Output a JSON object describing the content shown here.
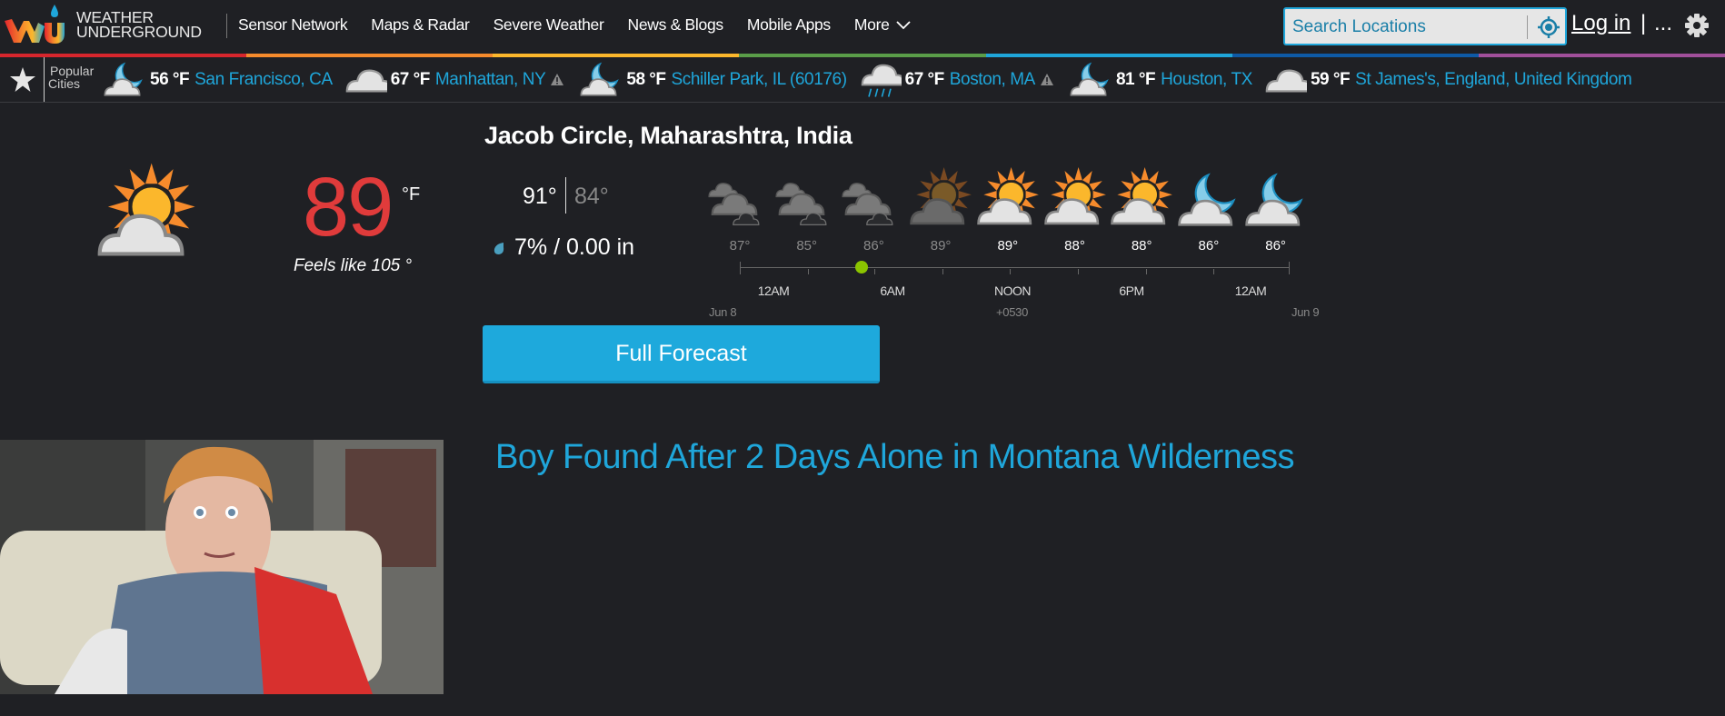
{
  "header": {
    "logo_line1": "WEATHER",
    "logo_line2": "UNDERGROUND",
    "nav": [
      "Sensor Network",
      "Maps & Radar",
      "Severe Weather",
      "News & Blogs",
      "Mobile Apps",
      "More"
    ],
    "search_placeholder": "Search Locations",
    "login_label": "Log in",
    "separator": "|",
    "more_label": "...",
    "brand_colors": [
      "#d7262d",
      "#f68b2c",
      "#fbb72c",
      "#5a9d49",
      "#1fa6da",
      "#0e5aa6",
      "#a04f9a"
    ]
  },
  "popular_cities": {
    "label_line1": "Popular",
    "label_line2": "Cities",
    "items": [
      {
        "icon": "night-partly-cloudy-icon",
        "temp": "56 °F",
        "name": "San Francisco, CA",
        "alert": false
      },
      {
        "icon": "cloudy-icon",
        "temp": "67 °F",
        "name": "Manhattan, NY",
        "alert": true
      },
      {
        "icon": "night-partly-cloudy-icon",
        "temp": "58 °F",
        "name": "Schiller Park, IL (60176)",
        "alert": false
      },
      {
        "icon": "rain-icon",
        "temp": "67 °F",
        "name": "Boston, MA",
        "alert": true
      },
      {
        "icon": "night-partly-cloudy-icon",
        "temp": "81 °F",
        "name": "Houston, TX",
        "alert": false
      },
      {
        "icon": "cloudy-icon",
        "temp": "59 °F",
        "name": "St James's, England, United Kingdom",
        "alert": false
      }
    ]
  },
  "current": {
    "location": "Jacob Circle, Maharashtra, India",
    "icon": "partly-cloudy-icon",
    "temp": "89",
    "unit": "°F",
    "feels_like": "Feels like 105 °",
    "high": "91°",
    "low": "84°",
    "precip": "7% / 0.00 in",
    "temp_color": "#e03b3b"
  },
  "hourly": {
    "items": [
      {
        "icon": "mostly-cloudy-icon",
        "temp": "87°",
        "past": true
      },
      {
        "icon": "mostly-cloudy-icon",
        "temp": "85°",
        "past": true
      },
      {
        "icon": "mostly-cloudy-icon",
        "temp": "86°",
        "past": true
      },
      {
        "icon": "partly-cloudy-icon",
        "temp": "89°",
        "past": true
      },
      {
        "icon": "partly-cloudy-icon",
        "temp": "89°",
        "past": false
      },
      {
        "icon": "partly-cloudy-icon",
        "temp": "88°",
        "past": false
      },
      {
        "icon": "partly-cloudy-icon",
        "temp": "88°",
        "past": false
      },
      {
        "icon": "night-partly-cloudy-icon",
        "temp": "86°",
        "past": false
      },
      {
        "icon": "night-partly-cloudy-icon",
        "temp": "86°",
        "past": false
      }
    ],
    "time_labels": [
      "12AM",
      "6AM",
      "NOON",
      "6PM",
      "12AM"
    ],
    "date_start": "Jun 8",
    "timezone": "+0530",
    "date_end": "Jun 9"
  },
  "full_forecast_label": "Full Forecast",
  "news": {
    "headline": "Boy Found After 2 Days Alone in Montana Wilderness"
  }
}
